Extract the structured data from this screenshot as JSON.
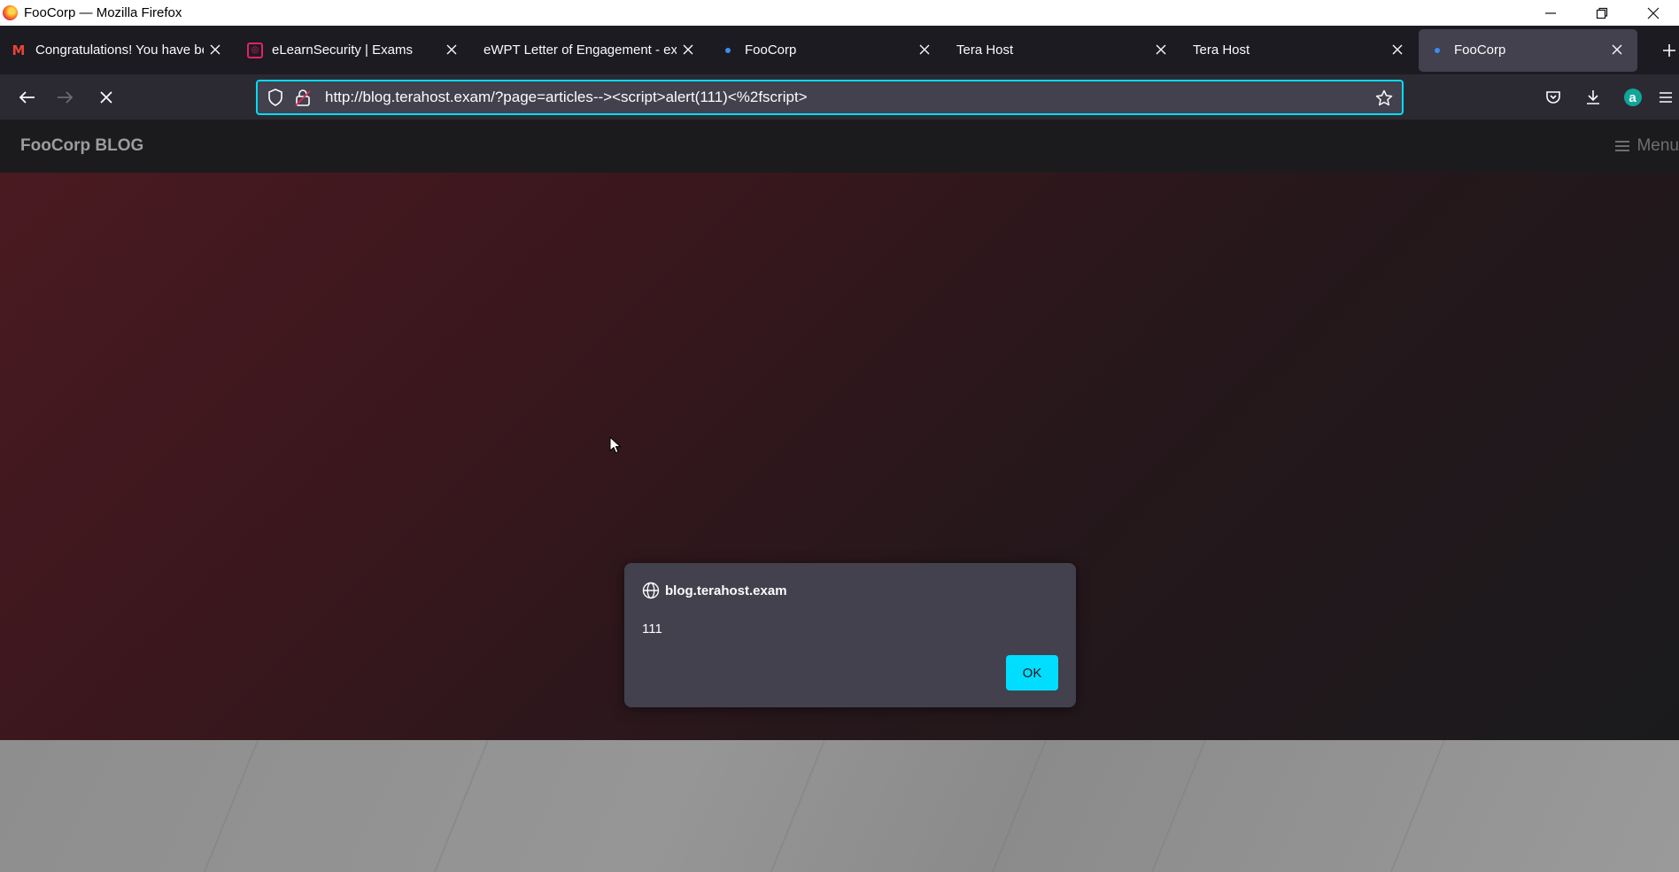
{
  "window": {
    "title": "FooCorp — Mozilla Firefox",
    "controls": {
      "minimize": "—",
      "restore": "❐",
      "close": "✕"
    }
  },
  "tabs": [
    {
      "title": "Congratulations! You have bee",
      "icon": "gmail-icon",
      "active": false
    },
    {
      "title": "eLearnSecurity | Exams",
      "icon": "elearnsecurity-icon",
      "active": false
    },
    {
      "title": "eWPT Letter of Engagement - exa",
      "icon": "none",
      "active": false
    },
    {
      "title": "FooCorp",
      "icon": "loading-dot-icon",
      "active": false
    },
    {
      "title": "Tera Host",
      "icon": "none",
      "active": false
    },
    {
      "title": "Tera Host",
      "icon": "none",
      "active": false
    },
    {
      "title": "FooCorp",
      "icon": "loading-dot-icon",
      "active": true
    }
  ],
  "navbar": {
    "url": "http://blog.terahost.exam/?page=articles--><script>alert(111)<%2fscript>"
  },
  "site": {
    "brand": "FooCorp BLOG",
    "menu_label": "Menu"
  },
  "dialog": {
    "origin": "blog.terahost.exam",
    "message": "111",
    "ok_label": "OK"
  },
  "colors": {
    "accent": "#00ddff",
    "tab_active_bg": "#42414d",
    "toolbar_bg": "#2b2a33",
    "tabstrip_bg": "#1c1b22",
    "hero_red": "#4a1a21"
  }
}
